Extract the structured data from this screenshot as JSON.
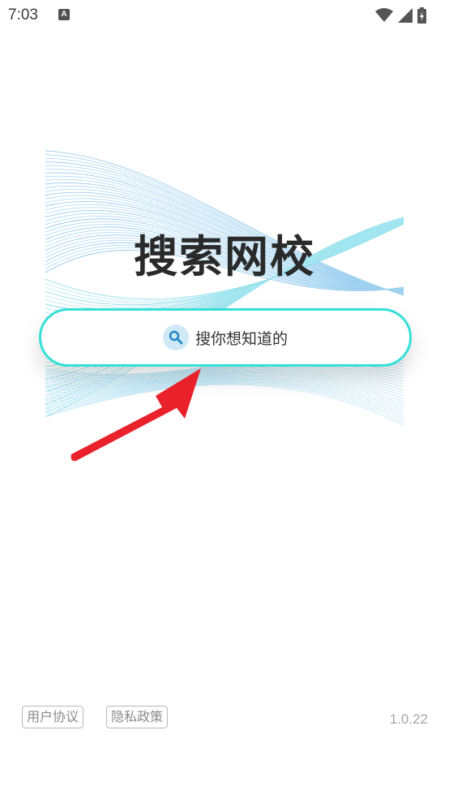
{
  "status_bar": {
    "time": "7:03",
    "notification_icon": "text-a-icon",
    "wifi_icon": "wifi-icon",
    "signal_icon": "signal-icon",
    "battery_icon": "battery-charging-icon"
  },
  "app": {
    "title": "搜索网校"
  },
  "search": {
    "placeholder": "搜你想知道的",
    "icon": "search-icon",
    "border_color": "#34e0d8"
  },
  "annotation": {
    "arrow_color": "#e8212b"
  },
  "footer": {
    "user_agreement": "用户协议",
    "privacy_policy": "隐私政策",
    "version": "1.0.22"
  }
}
